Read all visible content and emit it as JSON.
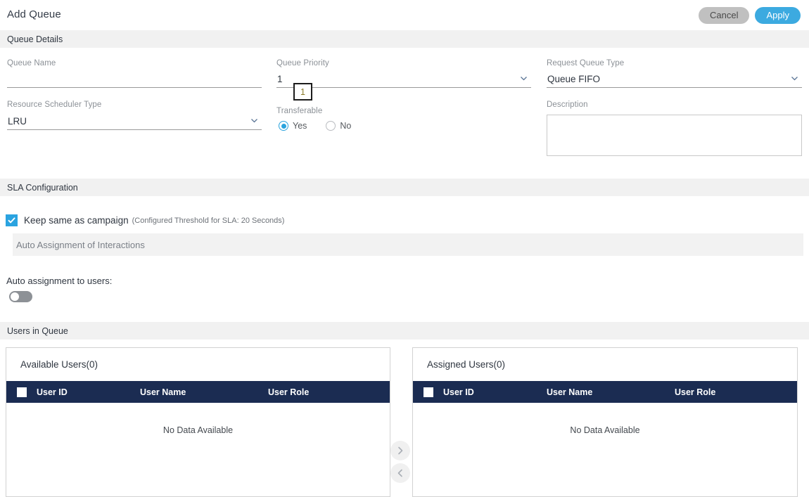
{
  "header": {
    "title": "Add Queue",
    "cancel_label": "Cancel",
    "apply_label": "Apply"
  },
  "sections": {
    "queue_details": "Queue Details",
    "sla_configuration": "SLA Configuration",
    "auto_assignment": "Auto Assignment of Interactions",
    "users_in_queue": "Users in Queue"
  },
  "form": {
    "queue_name": {
      "label": "Queue Name",
      "value": "",
      "placeholder": ""
    },
    "resource_scheduler_type": {
      "label": "Resource Scheduler Type",
      "value": "LRU"
    },
    "queue_priority": {
      "label": "Queue Priority",
      "value": "1",
      "tooltip": "1"
    },
    "transferable": {
      "label": "Transferable",
      "options": [
        {
          "label": "Yes",
          "selected": true
        },
        {
          "label": "No",
          "selected": false
        }
      ]
    },
    "request_queue_type": {
      "label": "Request Queue Type",
      "value": "Queue FIFO"
    },
    "description": {
      "label": "Description",
      "value": "",
      "placeholder": ""
    }
  },
  "sla": {
    "keep_same_label": "Keep same as campaign",
    "keep_same_note": "(Configured Threshold for SLA: 20 Seconds)",
    "keep_same_checked": true
  },
  "auto_assign": {
    "label": "Auto assignment to users:",
    "enabled": false
  },
  "tables": {
    "available": {
      "caption": "Available Users(0)",
      "columns": [
        "User ID",
        "User Name",
        "User Role"
      ],
      "rows": [],
      "empty_text": "No Data Available"
    },
    "assigned": {
      "caption": "Assigned Users(0)",
      "columns": [
        "User ID",
        "User Name",
        "User Role"
      ],
      "rows": [],
      "empty_text": "No Data Available"
    }
  },
  "colors": {
    "accent_blue": "#3caae0",
    "tab_blue": "#15559a",
    "table_header_navy": "#1b2c52",
    "band_gray": "#f1f1f1",
    "cancel_gray": "#c0c0c0"
  }
}
